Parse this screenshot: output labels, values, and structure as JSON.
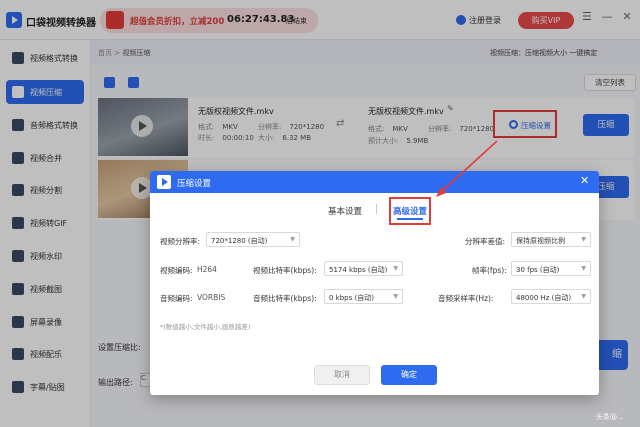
{
  "app": {
    "title": "口袋视频转换器",
    "login": "注册登录",
    "vip": "购买VIP",
    "menu_icon": "menu-icon",
    "min_icon": "minimize-icon",
    "close_icon": "close-icon"
  },
  "promo": {
    "text": "超值会员折扣，立减200",
    "countdown": "06:27:43.83",
    "end": "后结束"
  },
  "sidebar": {
    "items": [
      {
        "label": "视频格式转换",
        "icon": "format-convert-icon"
      },
      {
        "label": "视频压缩",
        "icon": "video-compress-icon",
        "active": true
      },
      {
        "label": "音频格式转换",
        "icon": "audio-convert-icon"
      },
      {
        "label": "视频合并",
        "icon": "video-merge-icon"
      },
      {
        "label": "视频分割",
        "icon": "video-split-icon"
      },
      {
        "label": "视频转GIF",
        "icon": "gif-icon"
      },
      {
        "label": "视频水印",
        "icon": "watermark-icon"
      },
      {
        "label": "视频截图",
        "icon": "screenshot-icon"
      },
      {
        "label": "屏幕录像",
        "icon": "screen-record-icon"
      },
      {
        "label": "视频配乐",
        "icon": "music-icon"
      },
      {
        "label": "字幕/贴图",
        "icon": "subtitle-icon"
      }
    ]
  },
  "breadcrumb": {
    "home": "首页",
    "sep": ">",
    "current": "视频压缩"
  },
  "top_setting": "视频压缩：压缩视频大小 一键搞定",
  "toolbar": {
    "clear": "清空列表"
  },
  "file": {
    "name_src": "无版权视频文件.mkv",
    "name_dst": "无版权视频文件.mkv",
    "format_label": "格式:",
    "format": "MKV",
    "res_label": "分辨率:",
    "res": "720*1280",
    "time_label": "时长:",
    "time": "00:00:10",
    "size_label": "大小:",
    "size": "6.32 MB",
    "est_label": "预计大小:",
    "est": "5.9MB",
    "compress_settings": "压缩设置",
    "compress_btn": "压缩"
  },
  "bottom": {
    "ratio_label": "设置压缩比:",
    "path_label": "输出路径:",
    "path_val": "C",
    "big_btn": "缩"
  },
  "dialog": {
    "title": "压缩设置",
    "tab_basic": "基本设置",
    "tab_advanced": "高级设置",
    "rows": {
      "res_label": "视频分辨率:",
      "res_val": "720*1280 (自动)",
      "diff_label": "分辨率差值:",
      "diff_val": "保持原视频比例",
      "vcodec_label": "视频编码:",
      "vcodec_val": "H264",
      "vbit_label": "视频比特率(kbps):",
      "vbit_val": "5174 kbps (自动)",
      "fps_label": "帧率(fps):",
      "fps_val": "30 fps (自动)",
      "acodec_label": "音频编码:",
      "acodec_val": "VORBIS",
      "abit_label": "音频比特率(kbps):",
      "abit_val": "0 kbps (自动)",
      "arate_label": "音频采样率(Hz):",
      "arate_val": "48000 Hz (自动)"
    },
    "hint": "*(数值越小,文件越小,画质越差)",
    "cancel": "取消",
    "ok": "确定"
  },
  "watermark": "头条@..."
}
